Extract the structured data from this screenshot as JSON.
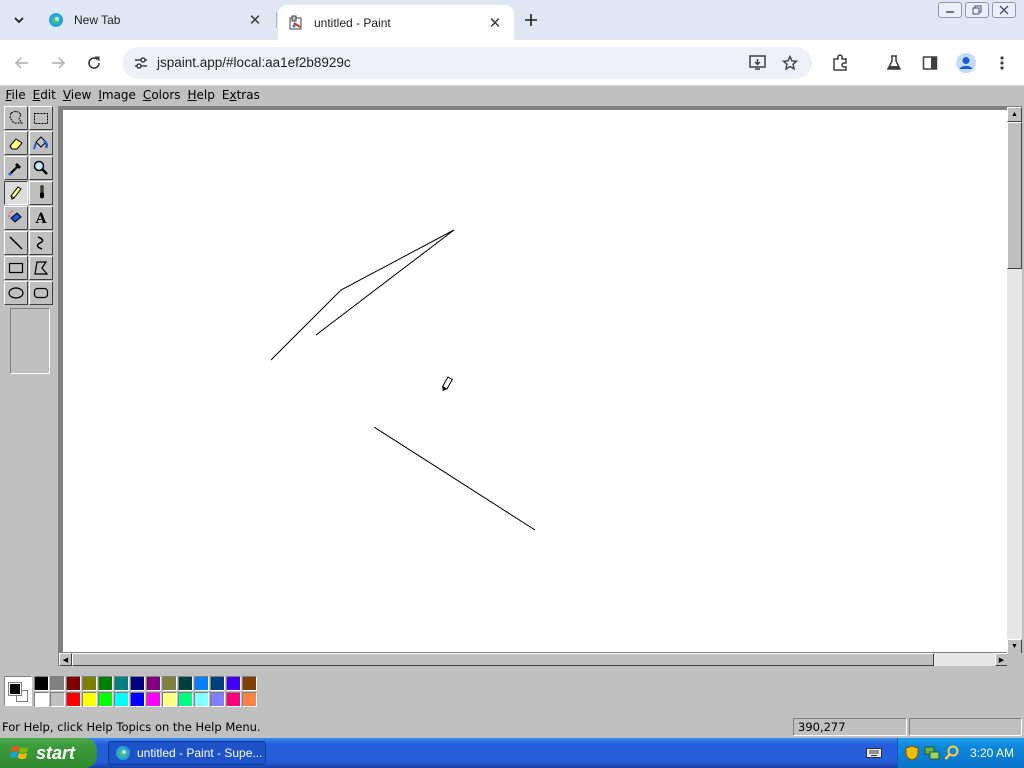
{
  "browser": {
    "tabs": [
      {
        "title": "New Tab",
        "active": false
      },
      {
        "title": "untitled - Paint",
        "active": true
      }
    ],
    "url": "jspaint.app/#local:aa1ef2b8929c"
  },
  "paint": {
    "menus": [
      {
        "pre": "",
        "acc": "F",
        "post": "ile"
      },
      {
        "pre": "",
        "acc": "E",
        "post": "dit"
      },
      {
        "pre": "",
        "acc": "V",
        "post": "iew"
      },
      {
        "pre": "",
        "acc": "I",
        "post": "mage"
      },
      {
        "pre": "",
        "acc": "C",
        "post": "olors"
      },
      {
        "pre": "",
        "acc": "H",
        "post": "elp"
      },
      {
        "pre": "E",
        "acc": "x",
        "post": "tras"
      }
    ],
    "tools": [
      "free-form-select",
      "select",
      "eraser",
      "fill-with-color",
      "pick-color",
      "magnifier",
      "pencil",
      "brush",
      "airbrush",
      "text",
      "line",
      "curve",
      "rectangle",
      "polygon",
      "ellipse",
      "rounded-rectangle"
    ],
    "selected_tool": "pencil",
    "foreground_color": "#000000",
    "background_color": "#ffffff",
    "palette_top": [
      "#000000",
      "#808080",
      "#800000",
      "#808000",
      "#008000",
      "#008080",
      "#000080",
      "#800080",
      "#808040",
      "#004040",
      "#0080ff",
      "#004080",
      "#4000ff",
      "#804000"
    ],
    "palette_bottom": [
      "#ffffff",
      "#c0c0c0",
      "#ff0000",
      "#ffff00",
      "#00ff00",
      "#00ffff",
      "#0000ff",
      "#ff00ff",
      "#ffff80",
      "#00ff80",
      "#80ffff",
      "#8080ff",
      "#ff0080",
      "#ff8040"
    ],
    "status_text": "For Help, click Help Topics on the Help Menu.",
    "cursor_position": "390,277"
  },
  "taskbar": {
    "start_label": "start",
    "task_label": "untitled - Paint - Supe...",
    "clock": "3:20 AM"
  }
}
